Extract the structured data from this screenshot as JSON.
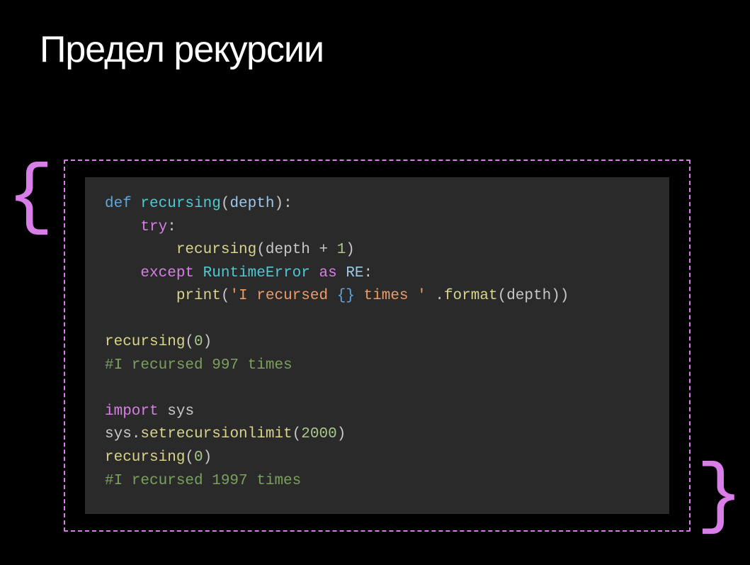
{
  "title": "Предел рекурсии",
  "braces": {
    "left": "{",
    "right": "}"
  },
  "code": {
    "l1": {
      "def": "def",
      "fn": "recursing",
      "op": "(",
      "p1": "depth",
      "cp": "):"
    },
    "l2": {
      "try": "try",
      "colon": ":"
    },
    "l3": {
      "fn": "recursing",
      "op": "(",
      "p1": "depth",
      "plus": " + ",
      "n1": "1",
      "cp": ")"
    },
    "l4": {
      "except": "except",
      "cls": "RuntimeError",
      "as": "as",
      "var": "RE",
      "colon": ":"
    },
    "l5": {
      "fn": "print",
      "op": "(",
      "s1": "'I recursed ",
      "esc": "{}",
      "s2": " times '",
      "sp": " .",
      "fmt": "format",
      "op2": "(",
      "p1": "depth",
      "cp2": "))"
    },
    "l6": {
      "fn": "recursing",
      "op": "(",
      "n1": "0",
      "cp": ")"
    },
    "l7": "#I recursed 997 times",
    "l8": {
      "import": "import",
      "mod": "sys"
    },
    "l9": {
      "mod": "sys",
      "dot": ".",
      "fn": "setrecursionlimit",
      "op": "(",
      "n1": "2000",
      "cp": ")"
    },
    "l10": {
      "fn": "recursing",
      "op": "(",
      "n1": "0",
      "cp": ")"
    },
    "l11": "#I recursed 1997 times"
  }
}
